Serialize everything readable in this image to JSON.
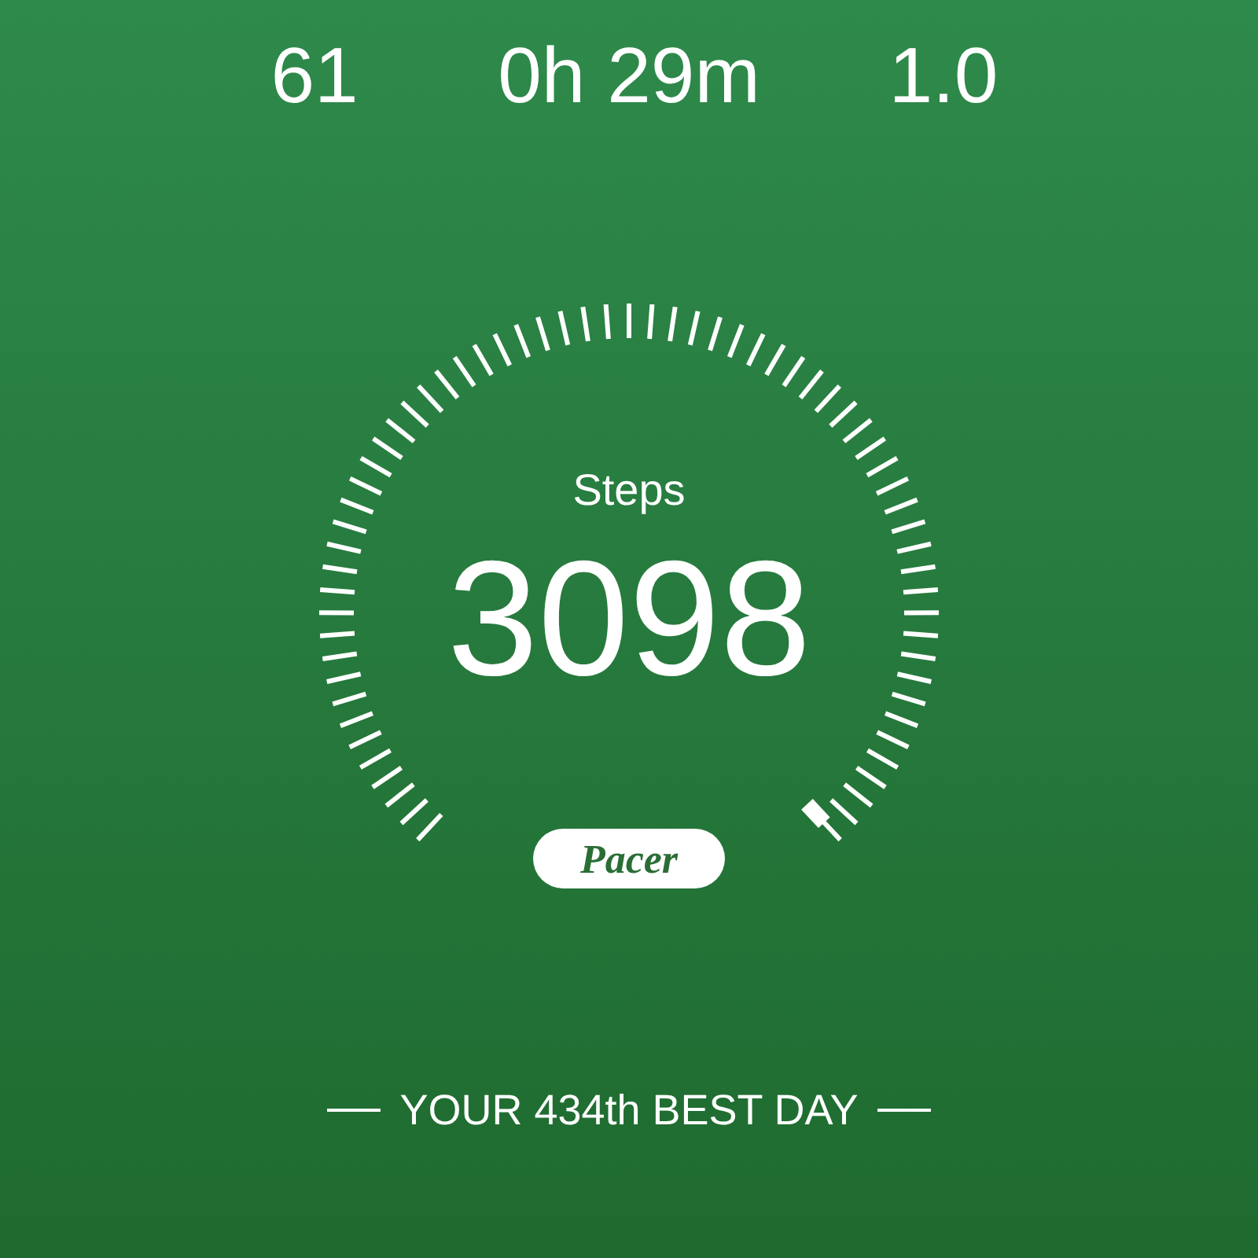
{
  "stats": [
    {
      "value": "61"
    },
    {
      "value": "0h 29m"
    },
    {
      "value": "1.0"
    }
  ],
  "gauge": {
    "label": "Steps",
    "value": "3098"
  },
  "badge": {
    "text": "Pacer"
  },
  "footer": {
    "text": "YOUR 434th BEST DAY"
  }
}
